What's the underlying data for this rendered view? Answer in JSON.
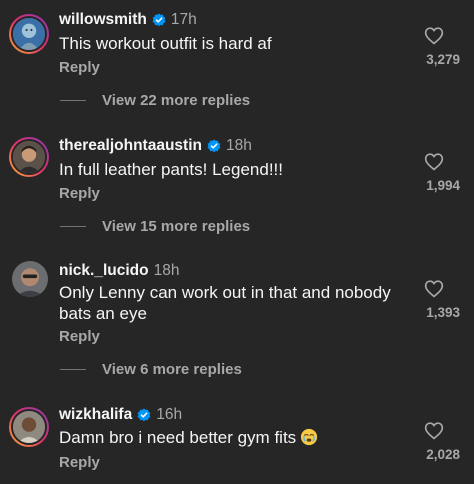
{
  "comments": [
    {
      "username": "willowsmith",
      "verified": true,
      "time": "17h",
      "text": "This workout outfit is hard af",
      "reply_label": "Reply",
      "likes": "3,279",
      "more_replies": "View 22 more replies"
    },
    {
      "username": "therealjohntaaustin",
      "verified": true,
      "time": "18h",
      "text": "In full leather pants! Legend!!!",
      "reply_label": "Reply",
      "likes": "1,994",
      "more_replies": "View 15 more replies"
    },
    {
      "username": "nick._lucido",
      "verified": false,
      "time": "18h",
      "text": "Only Lenny can work out in that and nobody bats an eye",
      "reply_label": "Reply",
      "likes": "1,393",
      "more_replies": "View 6 more replies"
    },
    {
      "username": "wizkhalifa",
      "verified": true,
      "time": "16h",
      "text": "Damn bro i need better gym fits",
      "emoji": "face-with-tears-emoji",
      "reply_label": "Reply",
      "likes": "2,028"
    }
  ],
  "colors": {
    "background": "#262626",
    "verified": "#0095f6",
    "muted": "#a8a8a8"
  }
}
